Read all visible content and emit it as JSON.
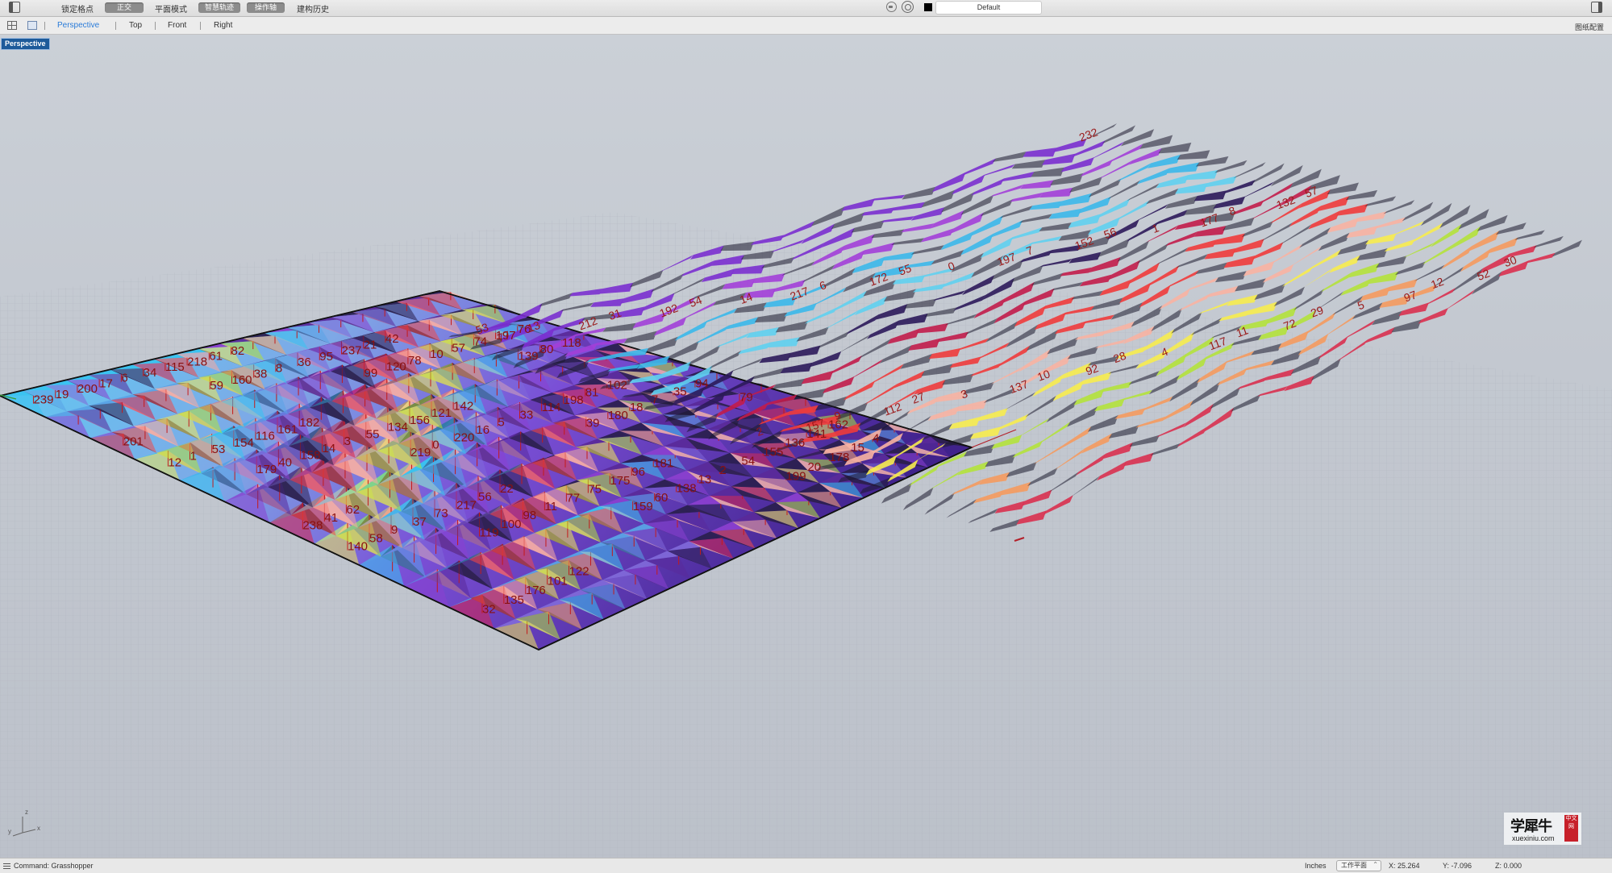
{
  "toolbar": {
    "grid_snap": "锁定格点",
    "ortho": "正交",
    "planar": "平面模式",
    "smart_track": "智慧轨迹",
    "gumball": "操作轴",
    "history": "建构历史",
    "layer_name": "Default",
    "layer_color": "#000000"
  },
  "viewtabs": {
    "tabs": [
      {
        "label": "Perspective",
        "active": true
      },
      {
        "label": "Top",
        "active": false
      },
      {
        "label": "Front",
        "active": false
      },
      {
        "label": "Right",
        "active": false
      }
    ],
    "layout_config": "图纸配置"
  },
  "viewport": {
    "label": "Perspective",
    "axis": {
      "x": "x",
      "y": "y",
      "z": "z"
    }
  },
  "scene": {
    "pattern_colors": [
      "#39c3f0",
      "#5aa2e6",
      "#7f68d8",
      "#8a3fcf",
      "#5a2a9a",
      "#2b2050",
      "#d7254a",
      "#ef4a4a",
      "#f8aaa0",
      "#f0ea58",
      "#b3e13a",
      "#f6a56b"
    ],
    "surface_labels": [
      "239",
      "219",
      "199",
      "179",
      "159",
      "139",
      "119",
      "99",
      "79",
      "59",
      "39",
      "19",
      "0",
      "20",
      "40",
      "60",
      "80",
      "100",
      "120",
      "140",
      "160",
      "180",
      "200",
      "220",
      "178",
      "158",
      "138",
      "118",
      "98",
      "78",
      "58",
      "38",
      "18",
      "17",
      "16",
      "15",
      "14",
      "13",
      "12",
      "11",
      "10",
      "9",
      "8",
      "7",
      "6",
      "5",
      "4",
      "3",
      "2",
      "1",
      "77",
      "57",
      "37",
      "36",
      "35",
      "34",
      "33",
      "32",
      "55",
      "54",
      "53",
      "75",
      "74",
      "73",
      "95",
      "94",
      "115",
      "114",
      "135",
      "134",
      "155",
      "154",
      "175",
      "197",
      "217",
      "237",
      "238",
      "218",
      "198",
      "176",
      "156",
      "136",
      "116",
      "96",
      "76",
      "56",
      "21",
      "41",
      "61",
      "81",
      "101",
      "121",
      "141",
      "161",
      "181",
      "201",
      "22",
      "42",
      "62",
      "82",
      "102",
      "122",
      "142",
      "162",
      "182"
    ],
    "strip_labels": [
      "53",
      "54",
      "55",
      "56",
      "57",
      "27",
      "28",
      "29",
      "30",
      "31",
      "6",
      "7",
      "8",
      "9",
      "10",
      "11",
      "12",
      "13",
      "14",
      "0",
      "1",
      "2",
      "3",
      "4",
      "5",
      "232",
      "192",
      "172",
      "152",
      "132",
      "112",
      "92",
      "72",
      "52",
      "212",
      "217",
      "197",
      "177",
      "157",
      "137",
      "117",
      "97",
      "77"
    ]
  },
  "statusbar": {
    "command": "Command: Grasshopper",
    "units": "Inches",
    "cplane": "工作平面",
    "x": "X: 25.264",
    "y": "Y: -7.096",
    "z": "Z: 0.000"
  },
  "watermark": {
    "cn": "学犀牛",
    "seal": "中文网",
    "url": "xuexiniu.com"
  }
}
